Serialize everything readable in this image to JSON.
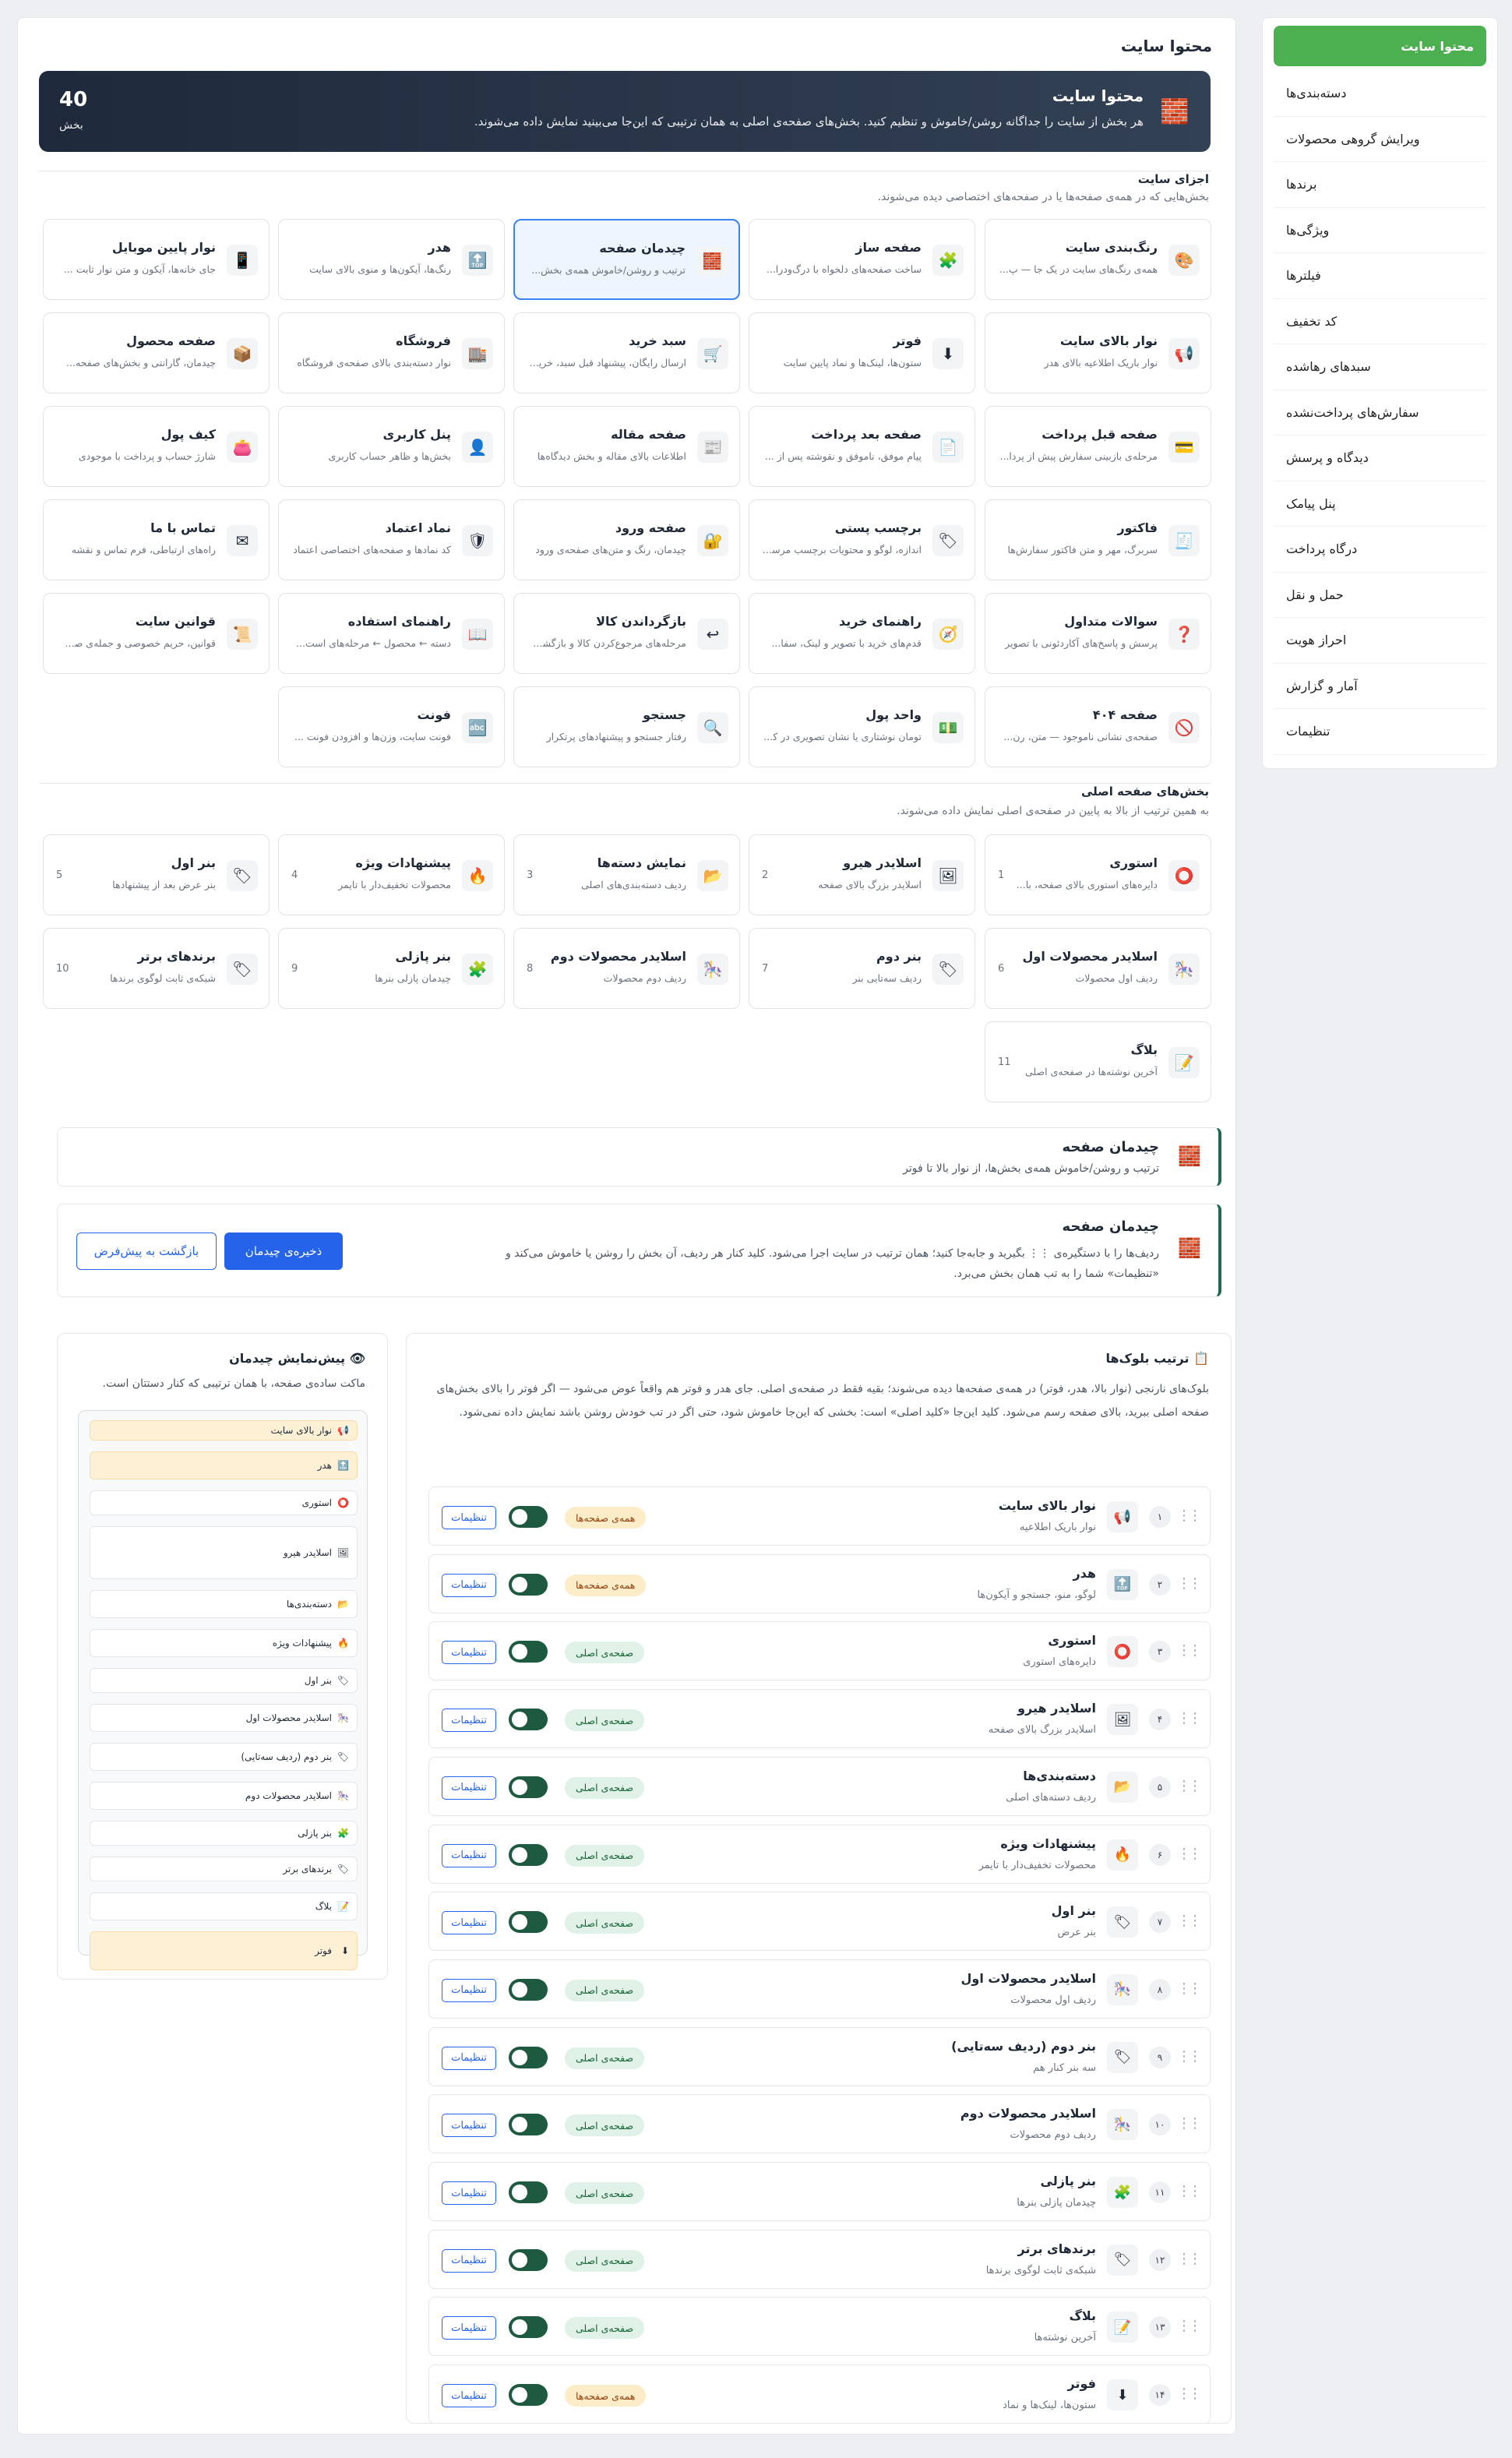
{
  "sidebar": {
    "items": [
      {
        "label": "محتوا سایت",
        "active": true
      },
      {
        "label": "دسته‌بندی‌ها"
      },
      {
        "label": "ویرایش گروهی محصولات"
      },
      {
        "label": "برندها"
      },
      {
        "label": "ویژگی‌ها"
      },
      {
        "label": "فیلترها"
      },
      {
        "label": "کد تخفیف"
      },
      {
        "label": "سبدهای رهاشده"
      },
      {
        "label": "سفارش‌های پرداخت‌نشده"
      },
      {
        "label": "دیدگاه و پرسش"
      },
      {
        "label": "پنل پیامک"
      },
      {
        "label": "درگاه پرداخت"
      },
      {
        "label": "حمل و نقل"
      },
      {
        "label": "احراز هویت"
      },
      {
        "label": "آمار و گزارش"
      },
      {
        "label": "تنظیمات"
      }
    ]
  },
  "page_title": "محتوا سایت",
  "hero": {
    "title": "محتوا سایت",
    "subtitle": "هر بخش از سایت را جداگانه روشن/خاموش و تنظیم کنید. بخش‌های صفحه‌ی اصلی به همان ترتیبی که این‌جا می‌بینید نمایش داده می‌شوند.",
    "count": "40",
    "count_label": "بخش",
    "icon": "brick-icon"
  },
  "parts": {
    "title": "اجزای سایت",
    "subtitle": "بخش‌هایی که در همه‌ی صفحه‌ها یا در صفحه‌های اختصاصی دیده می‌شوند.",
    "cards": [
      {
        "title": "رنگ‌بندی سایت",
        "desc": "همه‌ی رنگ‌های سایت در یک جا — پ...",
        "icon": "🎨"
      },
      {
        "title": "صفحه ساز",
        "desc": "ساخت صفحه‌های دلخواه با درگ‌ودرا...",
        "icon": "🧩"
      },
      {
        "title": "چیدمان صفحه",
        "desc": "ترتیب و روشن/خاموش همه‌ی بخش...",
        "icon": "🧱",
        "selected": true
      },
      {
        "title": "هدر",
        "desc": "رنگ‌ها، آیکون‌ها و منوی بالای سایت",
        "icon": "🔝"
      },
      {
        "title": "نوار پایین موبایل",
        "desc": "جای خانه‌ها، آیکون و متن نوار ثابت ...",
        "icon": "📱"
      },
      {
        "title": "نوار بالای سایت",
        "desc": "نوار باریک اطلاعیه بالای هدر",
        "icon": "📢"
      },
      {
        "title": "فوتر",
        "desc": "ستون‌ها، لینک‌ها و نماد پایین سایت",
        "icon": "⬇"
      },
      {
        "title": "سبد خرید",
        "desc": "ارسال رایگان، پیشنهاد قبل سبد، خرید...",
        "icon": "🛒"
      },
      {
        "title": "فروشگاه",
        "desc": "نوار دسته‌بندی بالای صفحه‌ی فروشگاه",
        "icon": "🏬"
      },
      {
        "title": "صفحه محصول",
        "desc": "چیدمان، گارانتی و بخش‌های صفحه...",
        "icon": "📦"
      },
      {
        "title": "صفحه قبل پرداخت",
        "desc": "مرحله‌ی بازبینی سفارش پیش از پردا...",
        "icon": "💳"
      },
      {
        "title": "صفحه بعد پرداخت",
        "desc": "پیام موفق، ناموفق و نقوشته پس از ...",
        "icon": "📄"
      },
      {
        "title": "صفحه مقاله",
        "desc": "اطلاعات بالای مقاله و بخش دیدگاه‌ها",
        "icon": "📰"
      },
      {
        "title": "پنل کاربری",
        "desc": "بخش‌ها و ظاهر حساب کاربری",
        "icon": "👤"
      },
      {
        "title": "کیف پول",
        "desc": "شارژ حساب و پرداخت با موجودی",
        "icon": "👛"
      },
      {
        "title": "فاکتور",
        "desc": "سربرگ، مهر و متن فاکتور سفارش‌ها",
        "icon": "🧾"
      },
      {
        "title": "برچسب پستی",
        "desc": "اندازه، لوگو و محتویات برچسب مرسوله",
        "icon": "🏷"
      },
      {
        "title": "صفحه ورود",
        "desc": "چیدمان، رنگ و متن‌های صفحه‌ی ورود",
        "icon": "🔐"
      },
      {
        "title": "نماد اعتماد",
        "desc": "کد نمادها و صفحه‌های اختصاصی اعتماد",
        "icon": "🛡"
      },
      {
        "title": "تماس با ما",
        "desc": "راه‌های ارتباطی، فرم تماس و نقشه",
        "icon": "✉"
      },
      {
        "title": "سوالات متداول",
        "desc": "پرسش و پاسخ‌های آکاردئونی با تصویر",
        "icon": "❓"
      },
      {
        "title": "راهنمای خرید",
        "desc": "قدم‌های خرید با تصویر و لینک، سفا...",
        "icon": "🧭"
      },
      {
        "title": "بازگرداندن کالا",
        "desc": "مرحله‌های مرجوع‌کردن کالا و بازگشت...",
        "icon": "↩"
      },
      {
        "title": "راهنمای استفاده",
        "desc": "دسته ← محصول ← مرحله‌های است...",
        "icon": "📖"
      },
      {
        "title": "قوانین سایت",
        "desc": "قوانین، حریم خصوصی و جمله‌ی صف...",
        "icon": "📜"
      },
      {
        "title": "صفحه ۴۰۴",
        "desc": "صفحه‌ی نشانی نامو‌جود — متن، رن...",
        "icon": "🚫"
      },
      {
        "title": "واحد پول",
        "desc": "تومان نوشتاری یا نشان تصویری در کا...",
        "icon": "💵"
      },
      {
        "title": "جستجو",
        "desc": "رفتار جستجو و پیشنهادهای پرتکرار",
        "icon": "🔍"
      },
      {
        "title": "فونت",
        "desc": "فونت سایت، وزن‌ها و افزودن فونت ...",
        "icon": "🔤"
      }
    ]
  },
  "home_sections": {
    "title": "بخش‌های صفحه اصلی",
    "subtitle": "به همین ترتیب از بالا به پایین در صفحه‌ی اصلی نمایش داده می‌شوند.",
    "cards": [
      {
        "title": "استوری",
        "desc": "دایره‌های استوری بالای صفحه، با...",
        "num": "1",
        "icon": "⭕"
      },
      {
        "title": "اسلایدر هیرو",
        "desc": "اسلایدر بزرگ بالای صفحه",
        "num": "2",
        "icon": "🖼"
      },
      {
        "title": "نمایش دسته‌ها",
        "desc": "ردیف دسته‌بندی‌های اصلی",
        "num": "3",
        "icon": "📂"
      },
      {
        "title": "پیشنهادات ویژه",
        "desc": "محصولات تخفیف‌دار با تایمر",
        "num": "4",
        "icon": "🔥"
      },
      {
        "title": "بنر اول",
        "desc": "بنر عرض بعد از پیشنهادها",
        "num": "5",
        "icon": "🏷"
      },
      {
        "title": "اسلایدر محصولات اول",
        "desc": "ردیف اول محصولات",
        "num": "6",
        "icon": "🎠"
      },
      {
        "title": "بنر دوم",
        "desc": "ردیف سه‌تایی بنر",
        "num": "7",
        "icon": "🏷"
      },
      {
        "title": "اسلایدر محصولات دوم",
        "desc": "ردیف دوم محصولات",
        "num": "8",
        "icon": "🎠"
      },
      {
        "title": "بنر پازلی",
        "desc": "چیدمان پازلی بنرها",
        "num": "9",
        "icon": "🧩"
      },
      {
        "title": "برندهای برتر",
        "desc": "شبکه‌ی ثابت لوگوی برندها",
        "num": "10",
        "icon": "🏷"
      },
      {
        "title": "بلاگ",
        "desc": "آخرین نوشته‌ها در صفحه‌ی اصلی",
        "num": "11",
        "icon": "📝"
      }
    ]
  },
  "layout_info": {
    "title": "چیدمان صفحه",
    "subtitle": "ترتیب و روشن/خاموش همه‌ی بخش‌ها، از نوار بالا تا فوتر"
  },
  "layout_help": {
    "title": "چیدمان صفحه",
    "text": "ردیف‌ها را با دستگیره‌ی ⋮⋮ بگیرید و جابه‌جا کنید؛ همان ترتیب در سایت اجرا می‌شود. کلید کنار هر ردیف، آن بخش را روشن یا خاموش می‌کند و «تنظیمات» شما را به تب همان بخش می‌برد.",
    "save_label": "ذخیره‌ی چیدمان",
    "reset_label": "بازگشت به پیش‌فرض"
  },
  "order_panel": {
    "title": "ترتیب بلوک‌ها",
    "desc": "بلوک‌های نارنجی (نوار بالا، هدر، فوتر) در همه‌ی صفحه‌ها دیده می‌شوند؛ بقیه فقط در صفحه‌ی اصلی. جای هدر و فوتر هم واقعاً عوض می‌شود — اگر فوتر را بالای بخش‌های صفحه اصلی ببرید، بالای صفحه رسم می‌شود. کلید این‌جا «کلید اصلی» است: بخشی که این‌جا خاموش شود، حتی اگر در تب خودش روشن باشد نمایش داده نمی‌شود.",
    "settings_label": "تنظیمات",
    "rows": [
      {
        "num": "۱",
        "title": "نوار بالای سایت",
        "desc": "نوار باریک اطلاعیه",
        "badge": "همه‌ی صفحه‌ها",
        "type": "all",
        "icon": "📢"
      },
      {
        "num": "۲",
        "title": "هدر",
        "desc": "لوگو، منو، جستجو و آیکون‌ها",
        "badge": "همه‌ی صفحه‌ها",
        "type": "all",
        "icon": "🔝"
      },
      {
        "num": "۳",
        "title": "استوری",
        "desc": "دایره‌های استوری",
        "badge": "صفحه‌ی اصلی",
        "type": "home",
        "icon": "⭕"
      },
      {
        "num": "۴",
        "title": "اسلایدر هیرو",
        "desc": "اسلایدر بزرگ بالای صفحه",
        "badge": "صفحه‌ی اصلی",
        "type": "home",
        "icon": "🖼"
      },
      {
        "num": "۵",
        "title": "دسته‌بندی‌ها",
        "desc": "ردیف دسته‌های اصلی",
        "badge": "صفحه‌ی اصلی",
        "type": "home",
        "icon": "📂"
      },
      {
        "num": "۶",
        "title": "پیشنهادات ویژه",
        "desc": "محصولات تخفیف‌دار با تایمر",
        "badge": "صفحه‌ی اصلی",
        "type": "home",
        "icon": "🔥"
      },
      {
        "num": "۷",
        "title": "بنر اول",
        "desc": "بنر عرض",
        "badge": "صفحه‌ی اصلی",
        "type": "home",
        "icon": "🏷"
      },
      {
        "num": "۸",
        "title": "اسلایدر محصولات اول",
        "desc": "ردیف اول محصولات",
        "badge": "صفحه‌ی اصلی",
        "type": "home",
        "icon": "🎠"
      },
      {
        "num": "۹",
        "title": "بنر دوم (ردیف سه‌تایی)",
        "desc": "سه بنر کنار هم",
        "badge": "صفحه‌ی اصلی",
        "type": "home",
        "icon": "🏷"
      },
      {
        "num": "۱۰",
        "title": "اسلایدر محصولات دوم",
        "desc": "ردیف دوم محصولات",
        "badge": "صفحه‌ی اصلی",
        "type": "home",
        "icon": "🎠"
      },
      {
        "num": "۱۱",
        "title": "بنر پازلی",
        "desc": "چیدمان پازلی بنرها",
        "badge": "صفحه‌ی اصلی",
        "type": "home",
        "icon": "🧩"
      },
      {
        "num": "۱۲",
        "title": "برندهای برتر",
        "desc": "شبکه‌ی ثابت لوگوی برندها",
        "badge": "صفحه‌ی اصلی",
        "type": "home",
        "icon": "🏷"
      },
      {
        "num": "۱۳",
        "title": "بلاگ",
        "desc": "آخرین نوشته‌ها",
        "badge": "صفحه‌ی اصلی",
        "type": "home",
        "icon": "📝"
      },
      {
        "num": "۱۴",
        "title": "فوتر",
        "desc": "ستون‌ها، لینک‌ها و نماد",
        "badge": "همه‌ی صفحه‌ها",
        "type": "all",
        "icon": "⬇"
      }
    ]
  },
  "preview": {
    "title": "پیش‌نمایش چیدمان",
    "desc": "ماکت ساده‌ی صفحه، با همان ترتیبی که کنار دستتان است.",
    "items": [
      {
        "label": "نوار بالای سایت",
        "icon": "📢",
        "hl": true
      },
      {
        "label": "هدر",
        "icon": "🔝",
        "hl": true
      },
      {
        "label": "استوری",
        "icon": "⭕"
      },
      {
        "label": "اسلایدر هیرو",
        "icon": "🖼"
      },
      {
        "label": "دسته‌بندی‌ها",
        "icon": "📂"
      },
      {
        "label": "پیشنهادات ویژه",
        "icon": "🔥"
      },
      {
        "label": "بنر اول",
        "icon": "🏷"
      },
      {
        "label": "اسلایدر محصولات اول",
        "icon": "🎠"
      },
      {
        "label": "بنر دوم (ردیف سه‌تایی)",
        "icon": "🏷"
      },
      {
        "label": "اسلایدر محصولات دوم",
        "icon": "🎠"
      },
      {
        "label": "بنر پازلی",
        "icon": "🧩"
      },
      {
        "label": "برندهای برتر",
        "icon": "🏷"
      },
      {
        "label": "بلاگ",
        "icon": "📝"
      },
      {
        "label": "فوتر",
        "icon": "⬇",
        "hl": true
      }
    ]
  }
}
